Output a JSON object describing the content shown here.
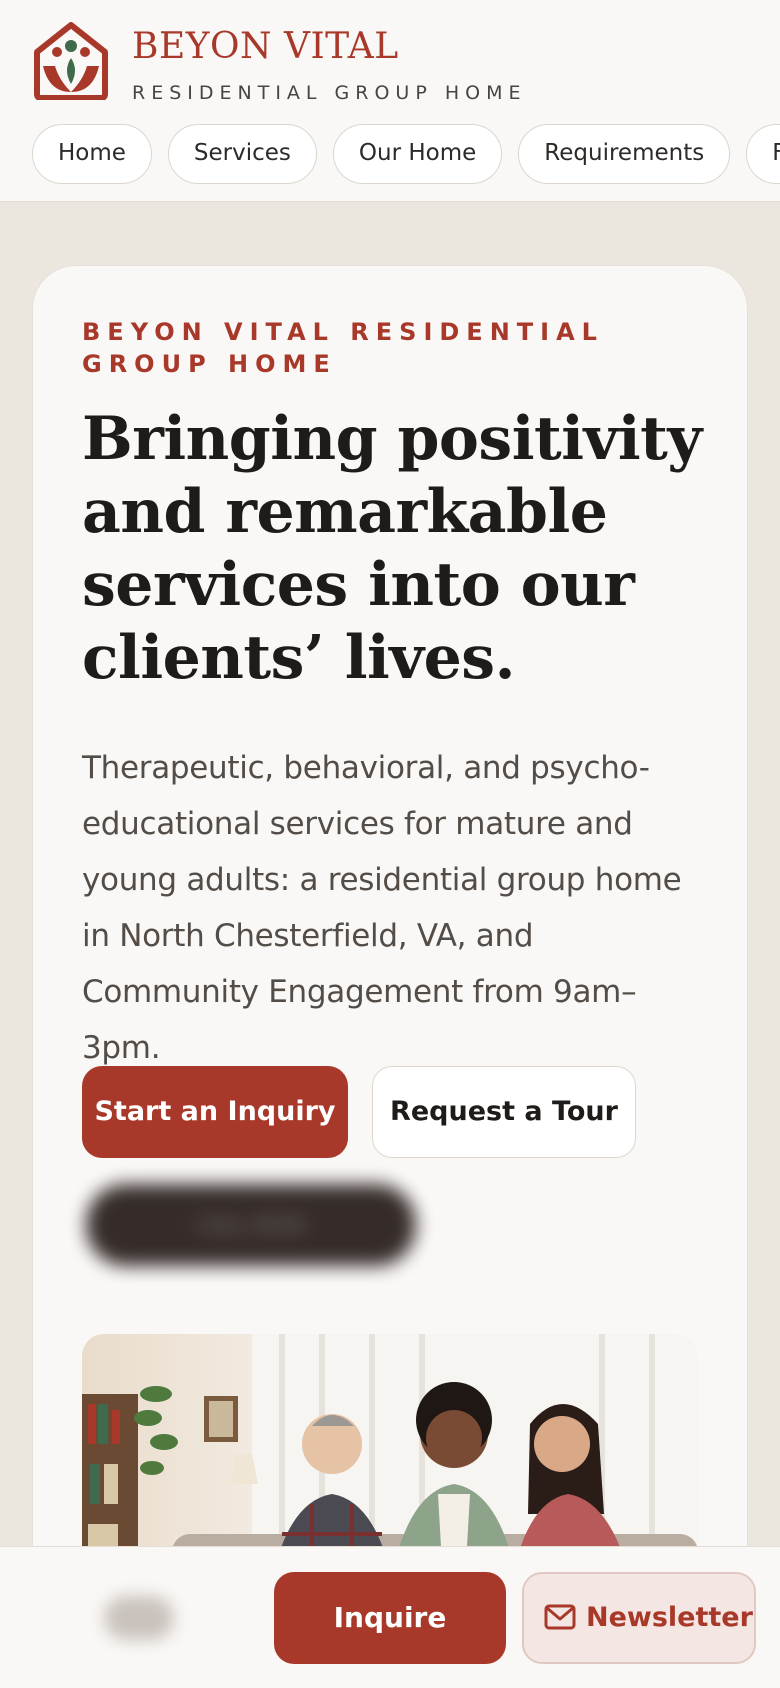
{
  "brand": {
    "name": "BEYON VITAL",
    "tagline": "RESIDENTIAL GROUP HOME",
    "logo_icon": "house-family-logo"
  },
  "nav": {
    "items": [
      {
        "label": "Home"
      },
      {
        "label": "Services"
      },
      {
        "label": "Our Home"
      },
      {
        "label": "Requirements"
      },
      {
        "label": "F"
      }
    ]
  },
  "hero": {
    "eyebrow": "BEYON VITAL RESIDENTIAL GROUP HOME",
    "title": "Bringing positivity and remarkable services into our clients’ lives.",
    "lede": "Therapeutic, behavioral, and psycho-educational services for mature and young adults: a residential group home in North Chesterfield, VA, and Community Engagement from 9am–3pm.",
    "primary_cta": "Start an Inquiry",
    "secondary_cta": "Request a Tour",
    "blurred_cta": "CALL NOW"
  },
  "bottom_bar": {
    "inquire_label": "Inquire",
    "newsletter_label": "Newsletter",
    "newsletter_icon": "mail-icon"
  },
  "colors": {
    "accent": "#a8392a",
    "background": "#ebe6de",
    "card": "#faf8f6",
    "text": "#1e1b19"
  }
}
